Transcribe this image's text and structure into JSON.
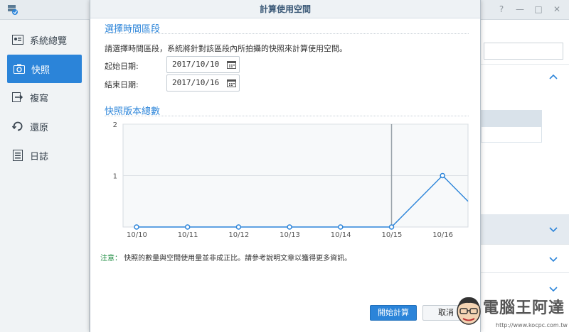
{
  "dialog": {
    "title": "計算使用空間",
    "section1_title": "選擇時間區段",
    "description": "請選擇時間區段，系統將針對該區段內所拍攝的快照來計算使用空間。",
    "start_label": "起始日期:",
    "start_value": "2017/10/10",
    "end_label": "結束日期:",
    "end_value": "2017/10/16",
    "section2_title": "快照版本總數",
    "note_label": "注意：",
    "note_text": "快照的數量與空間使用量並非成正比。請參考說明文章以獲得更多資訊。",
    "start_button": "開始計算",
    "cancel_button": "取消"
  },
  "sidebar": {
    "items": [
      {
        "label": "系統總覽",
        "icon": "overview-card-icon",
        "active": false
      },
      {
        "label": "快照",
        "icon": "camera-icon",
        "active": true
      },
      {
        "label": "複寫",
        "icon": "replicate-arrow-icon",
        "active": false
      },
      {
        "label": "還原",
        "icon": "restore-icon",
        "active": false
      },
      {
        "label": "日誌",
        "icon": "log-icon",
        "active": false
      }
    ]
  },
  "window_controls": [
    "?",
    "—",
    "□",
    "✕"
  ],
  "watermark": {
    "text": "電腦王阿達",
    "url": "http://www.kocpc.com.tw"
  },
  "colors": {
    "accent": "#2b84d9",
    "note_label": "#1a8a3e",
    "chart_line": "#2b84d9"
  },
  "chart_data": {
    "type": "line",
    "title": "",
    "categories": [
      "10/10",
      "10/11",
      "10/12",
      "10/13",
      "10/14",
      "10/15",
      "10/16"
    ],
    "series": [
      {
        "values": [
          0,
          0,
          0,
          0,
          0,
          0,
          1
        ]
      }
    ],
    "trailing_value": 0.5,
    "ylim": [
      0,
      2
    ],
    "yticks": [
      "1",
      "2"
    ],
    "marker_line_at": "10/15",
    "grid": true
  }
}
